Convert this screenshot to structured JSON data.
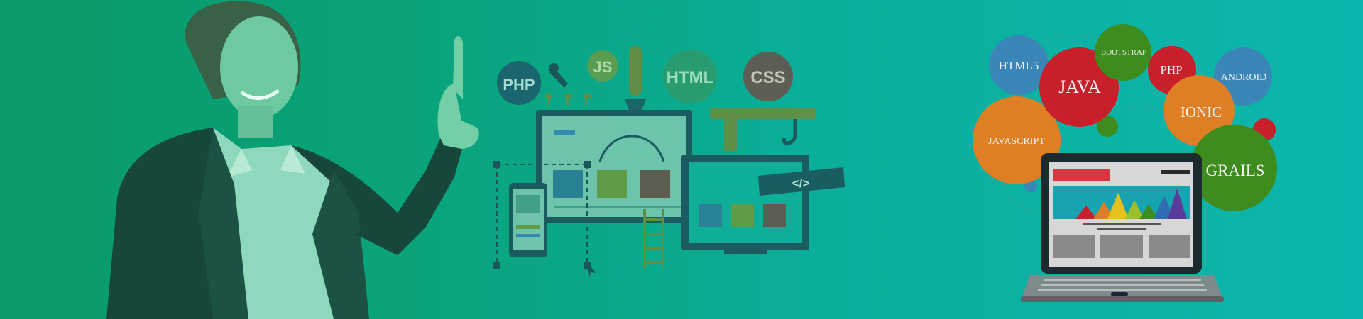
{
  "colors": {
    "bg_left": "#0b9a6a",
    "bg_right": "#0cb6ae",
    "overlay": "#0e8f77"
  },
  "center_art": {
    "bubbles": [
      "PHP",
      "JS",
      "HTML",
      "CSS"
    ],
    "code_tag": "</>"
  },
  "right_art": {
    "bubbles": [
      {
        "label": "HTML5",
        "color": "#3b86b8"
      },
      {
        "label": "JAVA",
        "color": "#c7202a"
      },
      {
        "label": "BOOTSTRAP",
        "color": "#3e8c1e"
      },
      {
        "label": "PHP",
        "color": "#c7202a"
      },
      {
        "label": "ANDROID",
        "color": "#3b86b8"
      },
      {
        "label": "IONIC",
        "color": "#de7e25"
      },
      {
        "label": "JAVASCRIPT",
        "color": "#de7e25"
      },
      {
        "label": "GRAILS",
        "color": "#3e8c1e"
      }
    ]
  }
}
